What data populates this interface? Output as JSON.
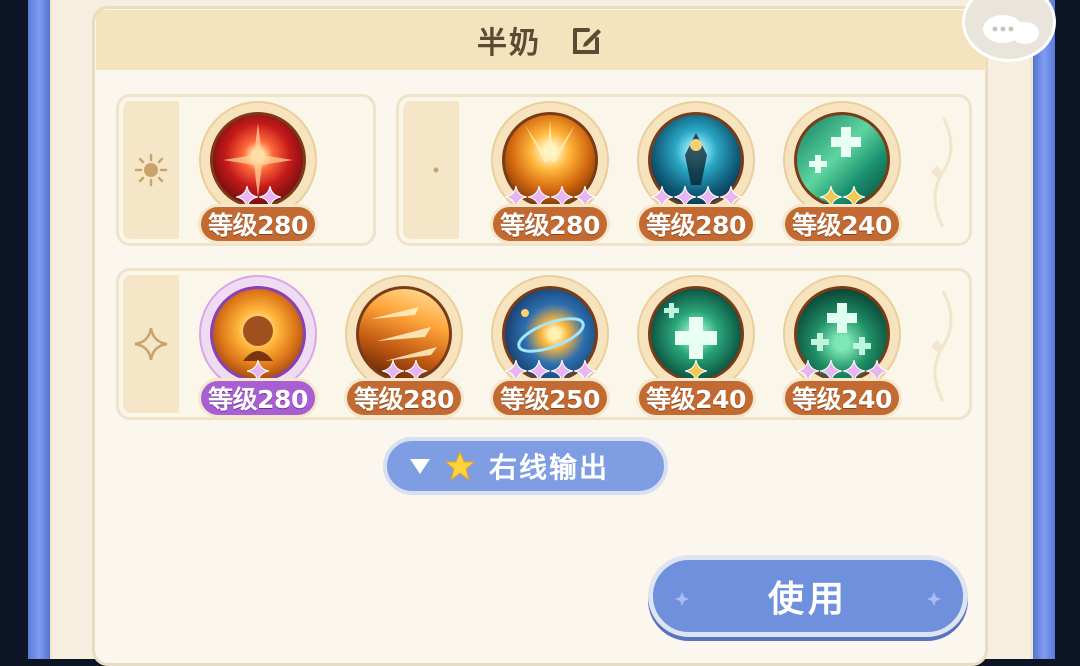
{
  "title": "半奶",
  "rows": [
    {
      "slot_icon": "sun-icon",
      "skills": [
        {
          "level": "等级280",
          "theme": "red",
          "stars": 2,
          "star_color": "#e9b4f2",
          "badge_color": "#c26a31"
        }
      ]
    },
    {
      "slot_icon": "moon-icon",
      "skills": [
        {
          "level": "等级280",
          "theme": "gold",
          "stars": 4,
          "star_color": "#e9b4f2",
          "badge_color": "#c26a31"
        },
        {
          "level": "等级280",
          "theme": "teal-dark",
          "stars": 4,
          "star_color": "#e9b4f2",
          "badge_color": "#c26a31"
        },
        {
          "level": "等级240",
          "theme": "green",
          "stars": 2,
          "star_color": "#f2c94c",
          "badge_color": "#c26a31"
        }
      ]
    },
    {
      "slot_icon": "sparkle-icon",
      "skills": [
        {
          "level": "等级280",
          "theme": "sun-purple",
          "stars": 1,
          "star_color": "#e9b4f2",
          "badge_color": "#a75fd3"
        },
        {
          "level": "等级280",
          "theme": "orange",
          "stars": 2,
          "star_color": "#e9b4f2",
          "badge_color": "#c26a31"
        },
        {
          "level": "等级250",
          "theme": "cosmic",
          "stars": 4,
          "star_color": "#e9b4f2",
          "badge_color": "#c26a31"
        },
        {
          "level": "等级240",
          "theme": "green",
          "stars": 1,
          "star_color": "#f2c94c",
          "badge_color": "#c26a31"
        },
        {
          "level": "等级240",
          "theme": "green-dark",
          "stars": 4,
          "star_color": "#e9b4f2",
          "badge_color": "#c26a31"
        }
      ]
    }
  ],
  "filter": {
    "label": "右线输出",
    "icons": [
      "triangle-down-icon",
      "star-icon"
    ]
  },
  "use_button": {
    "label": "使用"
  },
  "colors": {
    "accent": "#7f9de3",
    "badge": "#c26a31",
    "badge_purple": "#a75fd3"
  }
}
